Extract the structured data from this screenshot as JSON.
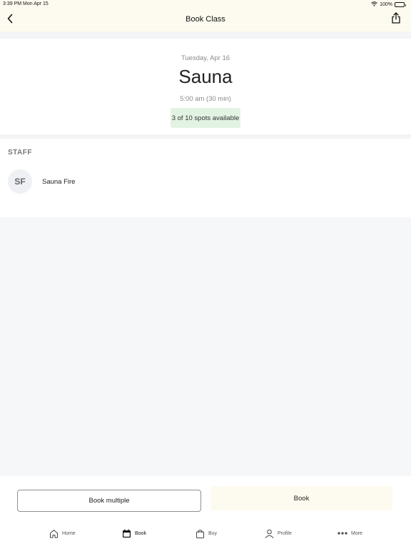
{
  "status_bar": {
    "time": "3:39 PM  Mon Apr 15",
    "battery": "100%",
    "battery_level": 1.0
  },
  "header": {
    "title": "Book Class",
    "back_icon": "chevron-left-icon",
    "share_icon": "share-icon"
  },
  "class_info": {
    "date": "Tuesday, Apr 16",
    "name": "Sauna",
    "time": "5:00 am (30 min)",
    "spots": "3 of 10 spots available"
  },
  "staff": {
    "heading": "STAFF",
    "members": [
      {
        "initials": "SF",
        "name": "Sauna Fire"
      }
    ]
  },
  "actions": {
    "book_multiple_label": "Book multiple",
    "book_label": "Book"
  },
  "tabs": [
    {
      "label": "Home",
      "icon": "home-icon",
      "active": false
    },
    {
      "label": "Book",
      "icon": "calendar-icon",
      "active": true
    },
    {
      "label": "Buy",
      "icon": "bag-icon",
      "active": false
    },
    {
      "label": "Profile",
      "icon": "person-icon",
      "active": false
    },
    {
      "label": "More",
      "icon": "more-dots-icon",
      "active": false
    }
  ],
  "colors": {
    "header_bg": "#fdfbef",
    "spots_badge_bg": "#e3f3e3",
    "page_bg": "#f6f7f9"
  }
}
